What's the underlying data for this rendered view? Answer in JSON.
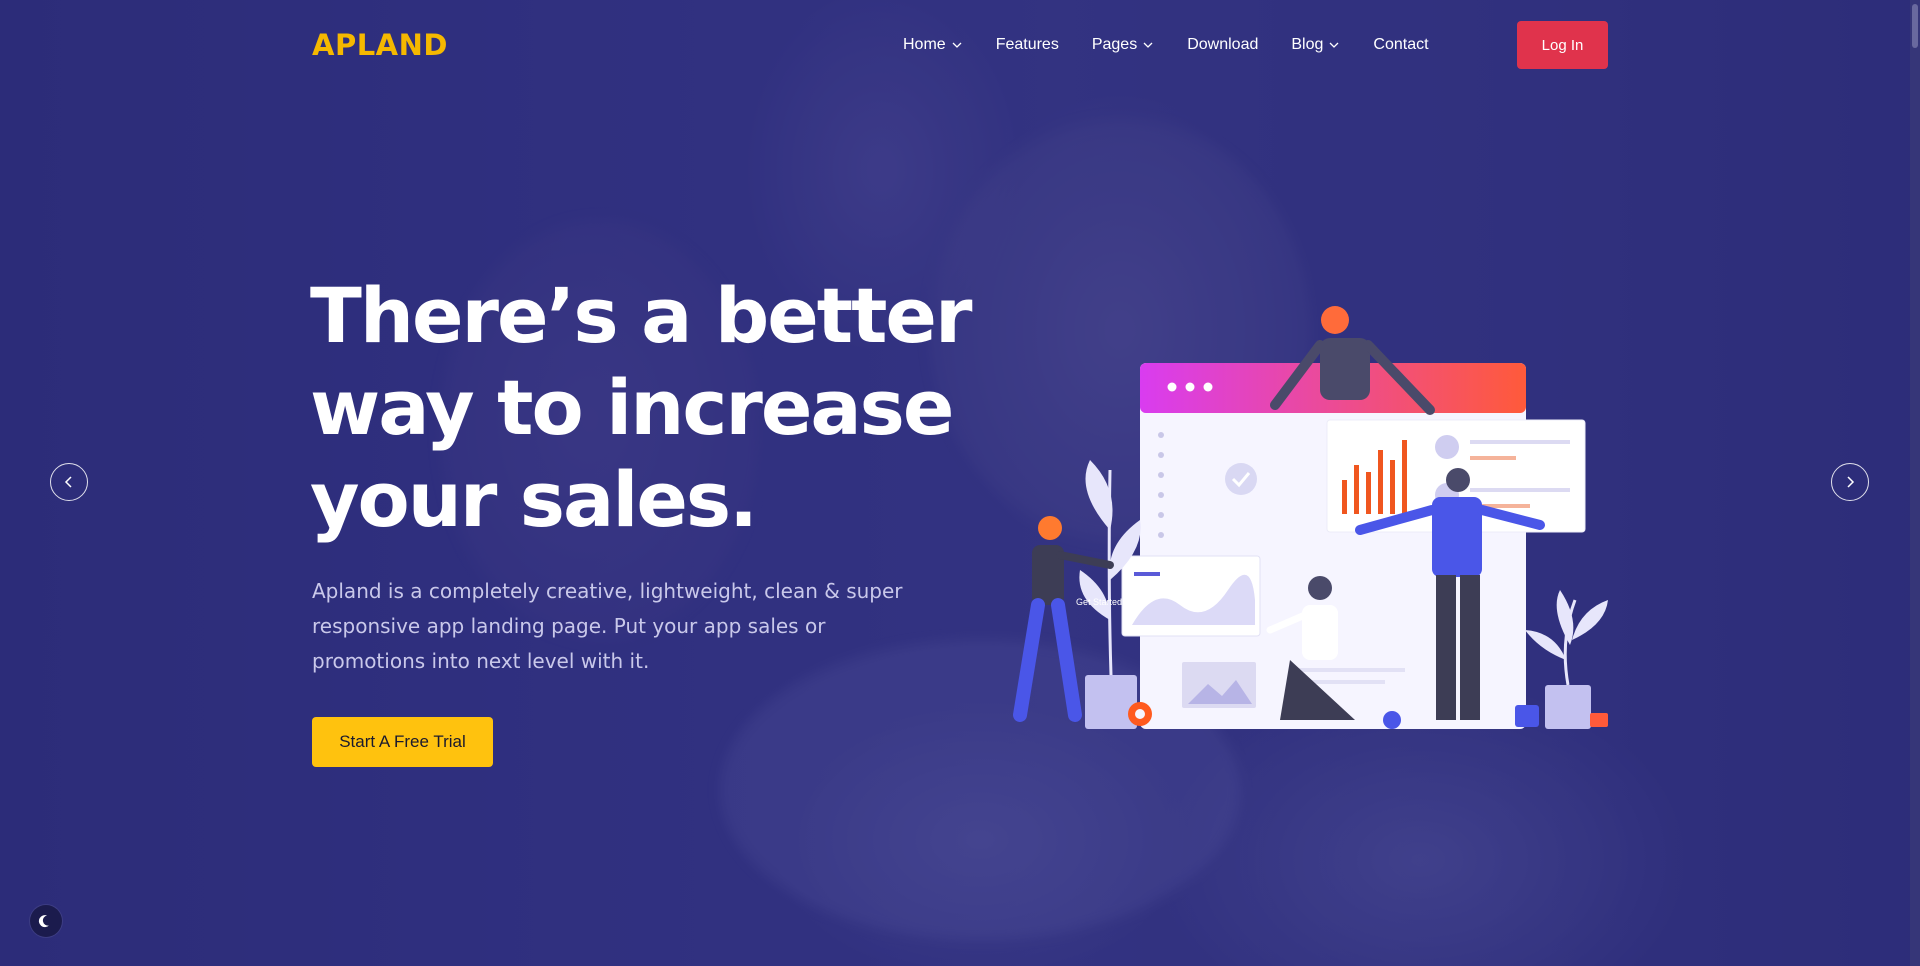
{
  "brand": {
    "name": "APLAND"
  },
  "nav": {
    "items": [
      {
        "label": "Home",
        "has_dropdown": true
      },
      {
        "label": "Features",
        "has_dropdown": false
      },
      {
        "label": "Pages",
        "has_dropdown": true
      },
      {
        "label": "Download",
        "has_dropdown": false
      },
      {
        "label": "Blog",
        "has_dropdown": true
      },
      {
        "label": "Contact",
        "has_dropdown": false
      }
    ],
    "login_label": "Log In"
  },
  "hero": {
    "title_lines": [
      "There’s a better",
      "way to increase",
      "your sales."
    ],
    "description": "Apland is a completely creative, lightweight, clean & super responsive app landing page. Put your app sales or promotions into next level with it.",
    "cta_label": "Start A Free Trial",
    "illustration_label": "Get Started"
  },
  "controls": {
    "prev_icon": "chevron-left-icon",
    "next_icon": "chevron-right-icon",
    "dark_mode_icon": "moon-icon"
  },
  "colors": {
    "overlay": "#2f2f7a",
    "brand": "#f5b800",
    "login_button": "#e0334c",
    "cta_button": "#ffc20e",
    "title_text": "#ffffff",
    "body_text": "#c9c8ea"
  }
}
